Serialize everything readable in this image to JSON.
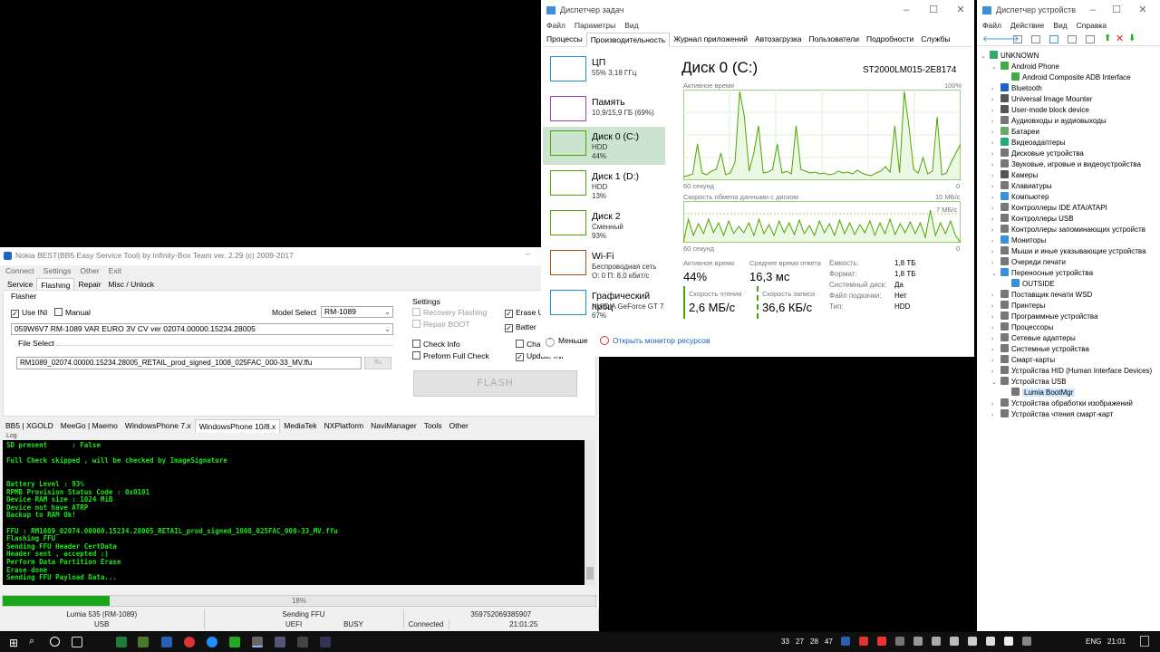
{
  "nokia": {
    "title": "Nokia BEST(BB5 Easy Service Tool) by Infinity-Box Team ver. 2.29 (c) 2009-2017",
    "menu": [
      "Connect",
      "Settings",
      "Other",
      "Exit"
    ],
    "tabs": [
      "Service",
      "Flashing",
      "Repair",
      "Misc / Unlock"
    ],
    "flasher_label": "Flasher",
    "use_ini": "Use INI",
    "manual": "Manual",
    "model_select_label": "Model Select",
    "model_value": "RM-1089",
    "product_value": "059W6V7 RM-1089 VAR EURO 3V CV ver 02074.00000.15234.28005",
    "file_select_label": "File Select",
    "file_value": "RM1089_02074.00000.15234.28005_RETAIL_prod_signed_1008_025FAC_000-33_MV.ffu",
    "ffu_btn": "ffu",
    "settings_label": "Settings",
    "recovery": "Recovery Flashing",
    "repair_boot": "Repair BOOT",
    "erase": "Erase U",
    "battery": "Batter",
    "check_info": "Check Info",
    "full_check": "Preform Full Check",
    "charge": "Char",
    "update": "Update INI",
    "flash_btn": "FLASH",
    "bottom_tabs": [
      "BB5 | XGOLD",
      "MeeGo | Maemo",
      "WindowsPhone 7.x",
      "WindowsPhone 10/8.x",
      "MediaTek",
      "NXPlatform",
      "NaviManager",
      "Tools",
      "Other"
    ],
    "log_label": "Log",
    "log": [
      "SD present      : False",
      "",
      "Full Check skipped , will be checked by ImageSignature",
      "",
      "",
      "Battery Level : 93%",
      "RPMB Provision Status Code : 0x0101",
      "Device RAM size : 1024 MiB",
      "Device not have ATRP",
      "Backup to RAM Ok!",
      "",
      "FFU : RM1089_02074.00000.15234.28005_RETAIL_prod_signed_1008_025FAC_000-33_MV.ffu",
      "Flashing FFU",
      "Sending FFU Header CertData",
      "Header sent , accepted :)",
      "Perform Data Partition Erase",
      "Erase done",
      "Sending FFU Payload Data..."
    ],
    "progress": 0.18,
    "progress_text": "18%",
    "status": [
      "Lumia 535 (RM-1089)",
      "Sending FFU",
      "359752069385907",
      "USB",
      "UEFI",
      "BUSY",
      "Connected",
      "21:01:25"
    ]
  },
  "tm": {
    "title": "Диспетчер задач",
    "menu": [
      "Файл",
      "Параметры",
      "Вид"
    ],
    "tabs": [
      "Процессы",
      "Производительность",
      "Журнал приложений",
      "Автозагрузка",
      "Пользователи",
      "Подробности",
      "Службы"
    ],
    "side": [
      {
        "name": "ЦП",
        "l1": "55%  3,18 ГГц",
        "l2": "",
        "color": "#1a8cd8"
      },
      {
        "name": "Память",
        "l1": "10,9/15,9 ГБ (69%)",
        "l2": "",
        "color": "#9b3fb5"
      },
      {
        "name": "Диск 0 (C:)",
        "l1": "HDD",
        "l2": "44%",
        "color": "#4ca600"
      },
      {
        "name": "Диск 1 (D:)",
        "l1": "HDD",
        "l2": "13%",
        "color": "#4ca600"
      },
      {
        "name": "Диск 2",
        "l1": "Сменный",
        "l2": "93%",
        "color": "#4ca600"
      },
      {
        "name": "Wi-Fi",
        "l1": "Беспроводная сеть",
        "l2": "О: 0 П: 8,0 кбит/с",
        "color": "#a7511a"
      },
      {
        "name": "Графический проц",
        "l1": "NVIDIA GeForce GT 740M",
        "l2": "67%",
        "color": "#1a8cd8"
      }
    ],
    "disk_title": "Диск 0 (C:)",
    "model": "ST2000LM015-2E8174",
    "active_label": "Активное время",
    "pct100": "100%",
    "sec60": "60 секунд",
    "zero": "0",
    "rate_label": "Скорость обмена данными с диском",
    "rate_max": "10 МБ/с",
    "rate_mark": "7 МБ/с",
    "stats": {
      "active": "Активное время",
      "active_v": "44%",
      "resp": "Среднее время ответа",
      "resp_v": "16,3 мс",
      "read": "Скорость чтения",
      "read_v": "2,6 МБ/с",
      "write": "Скорость записи",
      "write_v": "36,6 КБ/с"
    },
    "props": [
      [
        "Емкость:",
        "1,8 ТБ"
      ],
      [
        "Формат:",
        "1,8 ТБ"
      ],
      [
        "Системный диск:",
        "Да"
      ],
      [
        "Файл подкачки:",
        "Нет"
      ],
      [
        "Тип:",
        "HDD"
      ]
    ],
    "less": "Меньше",
    "monitor": "Открыть монитор ресурсов"
  },
  "dm": {
    "title": "Диспетчер устройств",
    "menu": [
      "Файл",
      "Действие",
      "Вид",
      "Справка"
    ],
    "tree": [
      {
        "t": "UNKNOWN",
        "d": 0,
        "c": "#3a6"
      },
      {
        "t": "Android Phone",
        "d": 1,
        "c": "#4a4"
      },
      {
        "t": "Android Composite ADB Interface",
        "d": 2,
        "c": "#4a4"
      },
      {
        "t": "Bluetooth",
        "d": 1,
        "c": "#1e64c8"
      },
      {
        "t": "Universal Image Mounter",
        "d": 1,
        "c": "#555"
      },
      {
        "t": "User-mode block device",
        "d": 1,
        "c": "#555"
      },
      {
        "t": "Аудиовходы и аудиовыходы",
        "d": 1,
        "c": "#777"
      },
      {
        "t": "Батареи",
        "d": 1,
        "c": "#6a6"
      },
      {
        "t": "Видеоадаптеры",
        "d": 1,
        "c": "#2a7"
      },
      {
        "t": "Дисковые устройства",
        "d": 1,
        "c": "#777"
      },
      {
        "t": "Звуковые, игровые и видеоустройства",
        "d": 1,
        "c": "#777"
      },
      {
        "t": "Камеры",
        "d": 1,
        "c": "#555"
      },
      {
        "t": "Клавиатуры",
        "d": 1,
        "c": "#777"
      },
      {
        "t": "Компьютер",
        "d": 1,
        "c": "#3a8fd8"
      },
      {
        "t": "Контроллеры IDE ATA/ATAPI",
        "d": 1,
        "c": "#777"
      },
      {
        "t": "Контроллеры USB",
        "d": 1,
        "c": "#777"
      },
      {
        "t": "Контроллеры запоминающих устройств",
        "d": 1,
        "c": "#777"
      },
      {
        "t": "Мониторы",
        "d": 1,
        "c": "#3a8fd8"
      },
      {
        "t": "Мыши и иные указывающие устройства",
        "d": 1,
        "c": "#777"
      },
      {
        "t": "Очереди печати",
        "d": 1,
        "c": "#777"
      },
      {
        "t": "Переносные устройства",
        "d": 1,
        "c": "#3a8fd8"
      },
      {
        "t": "OUTSIDE",
        "d": 2,
        "c": "#3a8fd8"
      },
      {
        "t": "Поставщик печати WSD",
        "d": 1,
        "c": "#777"
      },
      {
        "t": "Принтеры",
        "d": 1,
        "c": "#777"
      },
      {
        "t": "Программные устройства",
        "d": 1,
        "c": "#777"
      },
      {
        "t": "Процессоры",
        "d": 1,
        "c": "#777"
      },
      {
        "t": "Сетевые адаптеры",
        "d": 1,
        "c": "#777"
      },
      {
        "t": "Системные устройства",
        "d": 1,
        "c": "#777"
      },
      {
        "t": "Смарт-карты",
        "d": 1,
        "c": "#777"
      },
      {
        "t": "Устройства HID (Human Interface Devices)",
        "d": 1,
        "c": "#777"
      },
      {
        "t": "Устройства USB",
        "d": 1,
        "c": "#777"
      },
      {
        "t": "Lumia BootMgr",
        "d": 2,
        "c": "#777",
        "sel": true
      },
      {
        "t": "Устройства обработки изображений",
        "d": 1,
        "c": "#777"
      },
      {
        "t": "Устройства чтения смарт-карт",
        "d": 1,
        "c": "#777"
      }
    ]
  },
  "taskbar": {
    "lang": "ENG",
    "time": "21:01",
    "tray_nums": [
      "33",
      "27",
      "28",
      "47"
    ]
  }
}
